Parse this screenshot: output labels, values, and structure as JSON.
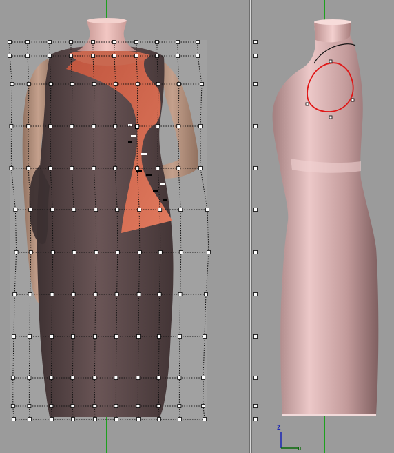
{
  "app": {
    "view_type": "Garment lattice deformation viewport"
  },
  "viewports": {
    "front": {
      "lattice_columns": 10,
      "lattice_rows": 10,
      "colors": {
        "grid_line": "#1ea01e",
        "lattice_point": "#ffffff",
        "lattice_line": "#111111",
        "dress_dark": "#5b4647",
        "dress_accent": "#d0684f",
        "skin": "#b48b72",
        "mannequin": "#e5b4b1"
      }
    },
    "side": {
      "selection_color": "#e01616",
      "mannequin_color": "#e8c0c0",
      "grid_line": "#1ea01e"
    }
  },
  "axis_indicator": {
    "z_label": "Z",
    "y_label": "u",
    "z_color": "#1a25b5",
    "y_color": "#0a6a0a"
  }
}
